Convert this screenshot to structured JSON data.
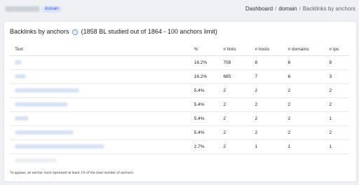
{
  "header": {
    "site_badge": "domain",
    "breadcrumbs": [
      "Dashboard",
      "domain",
      "Backlinks by anchors"
    ],
    "separator": "/"
  },
  "card": {
    "title": "Backlinks by anchors",
    "subtitle": "(1858 BL studied out of 1864 - 100 anchors limit)",
    "info_icon": "info-icon"
  },
  "table": {
    "columns": [
      "Text",
      "%",
      "# links",
      "# hosts",
      "# domains",
      "# ips"
    ],
    "rows": [
      {
        "pct": "16.2%",
        "links": "708",
        "hosts": "8",
        "domains": "6",
        "ips": "8"
      },
      {
        "pct": "16.2%",
        "links": "685",
        "hosts": "7",
        "domains": "6",
        "ips": "3"
      },
      {
        "pct": "5.4%",
        "links": "2",
        "hosts": "2",
        "domains": "2",
        "ips": "2"
      },
      {
        "pct": "5.4%",
        "links": "2",
        "hosts": "2",
        "domains": "2",
        "ips": "2"
      },
      {
        "pct": "5.4%",
        "links": "2",
        "hosts": "2",
        "domains": "2",
        "ips": "1"
      },
      {
        "pct": "5.4%",
        "links": "2",
        "hosts": "2",
        "domains": "2",
        "ips": "2"
      },
      {
        "pct": "2.7%",
        "links": "2",
        "hosts": "1",
        "domains": "1",
        "ips": "1"
      }
    ]
  },
  "footnote": "To appear, an anchor must represent at least 1% of the total number of anchors.",
  "colors": {
    "accent": "#3b5bdb",
    "badge_bg": "#dbe2fb",
    "page_bg": "#eef0f4"
  }
}
